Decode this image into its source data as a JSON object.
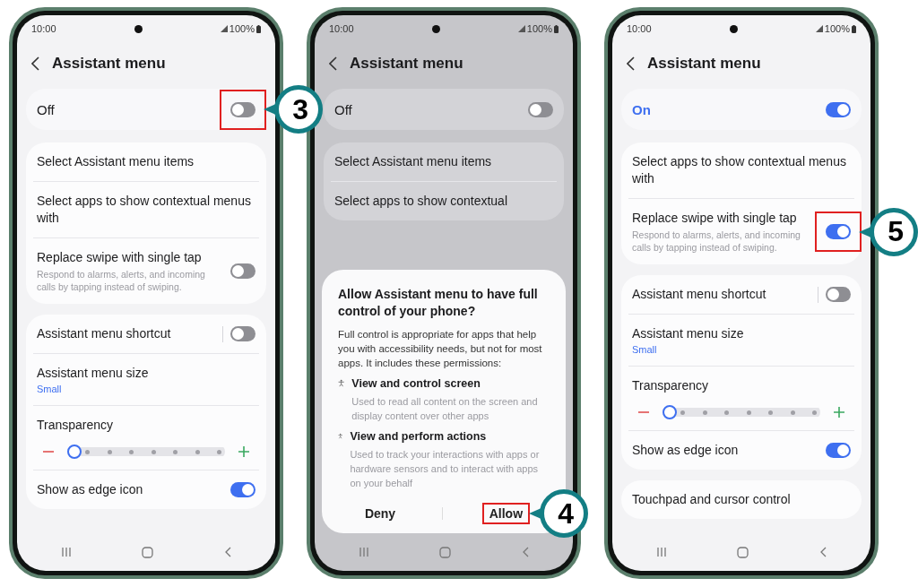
{
  "phones": [
    {
      "status": {
        "time": "10:00",
        "battery": "100%"
      },
      "title": "Assistant menu",
      "master": {
        "label": "Off",
        "on": false,
        "highlighted": true,
        "callout": "3"
      },
      "groups": [
        {
          "items": [
            {
              "kind": "link",
              "title": "Select Assistant menu items"
            },
            {
              "kind": "link",
              "title": "Select apps to show contextual menus with"
            },
            {
              "kind": "switch",
              "title": "Replace swipe with single tap",
              "description": "Respond to alarms, alerts, and incoming calls by tapping instead of swiping.",
              "on": false,
              "separator": false,
              "highlighted": false
            }
          ]
        },
        {
          "items": [
            {
              "kind": "switch",
              "title": "Assistant menu shortcut",
              "on": false,
              "separator": true,
              "highlighted": false
            },
            {
              "kind": "value",
              "title": "Assistant menu size",
              "value": "Small"
            },
            {
              "kind": "slider",
              "title": "Transparency",
              "level": 0
            },
            {
              "kind": "switch",
              "title": "Show as edge icon",
              "on": true,
              "separator": false,
              "highlighted": false
            }
          ]
        }
      ]
    },
    {
      "status": {
        "time": "10:00",
        "battery": "100%"
      },
      "title": "Assistant menu",
      "master": {
        "label": "Off",
        "on": false,
        "highlighted": false
      },
      "groups": [
        {
          "items": [
            {
              "kind": "link",
              "title": "Select Assistant menu items"
            },
            {
              "kind": "link",
              "title": "Select apps to show contextual"
            }
          ]
        }
      ],
      "dialog": {
        "title": "Allow Assistant menu to have full control of your phone?",
        "body": "Full control is appropriate for apps that help you with accessibility needs, but not for most apps. It includes these permissions:",
        "permissions": [
          {
            "title": "View and control screen",
            "description": "Used to read all content on the screen and display content over other apps"
          },
          {
            "title": "View and perform actions",
            "description": "Used to track your interactions with apps or hardware sensors and to interact with apps on your behalf"
          }
        ],
        "buttons": [
          {
            "label": "Deny",
            "highlighted": false
          },
          {
            "label": "Allow",
            "highlighted": true,
            "callout": "4"
          }
        ]
      }
    },
    {
      "status": {
        "time": "10:00",
        "battery": "100%"
      },
      "title": "Assistant menu",
      "master": {
        "label": "On",
        "on": true,
        "highlighted": false
      },
      "groups": [
        {
          "items": [
            {
              "kind": "link",
              "title": "Select apps to show contextual menus with"
            },
            {
              "kind": "switch",
              "title": "Replace swipe with single tap",
              "description": "Respond to alarms, alerts, and incoming calls by tapping instead of swiping.",
              "on": true,
              "separator": false,
              "highlighted": true,
              "callout": "5"
            }
          ]
        },
        {
          "items": [
            {
              "kind": "switch",
              "title": "Assistant menu shortcut",
              "on": false,
              "separator": true,
              "highlighted": false
            },
            {
              "kind": "value",
              "title": "Assistant menu size",
              "value": "Small"
            },
            {
              "kind": "slider",
              "title": "Transparency",
              "level": 0
            },
            {
              "kind": "switch",
              "title": "Show as edge icon",
              "on": true,
              "separator": false,
              "highlighted": false
            }
          ]
        },
        {
          "items": [
            {
              "kind": "link",
              "title": "Touchpad and cursor control"
            }
          ]
        }
      ]
    }
  ]
}
